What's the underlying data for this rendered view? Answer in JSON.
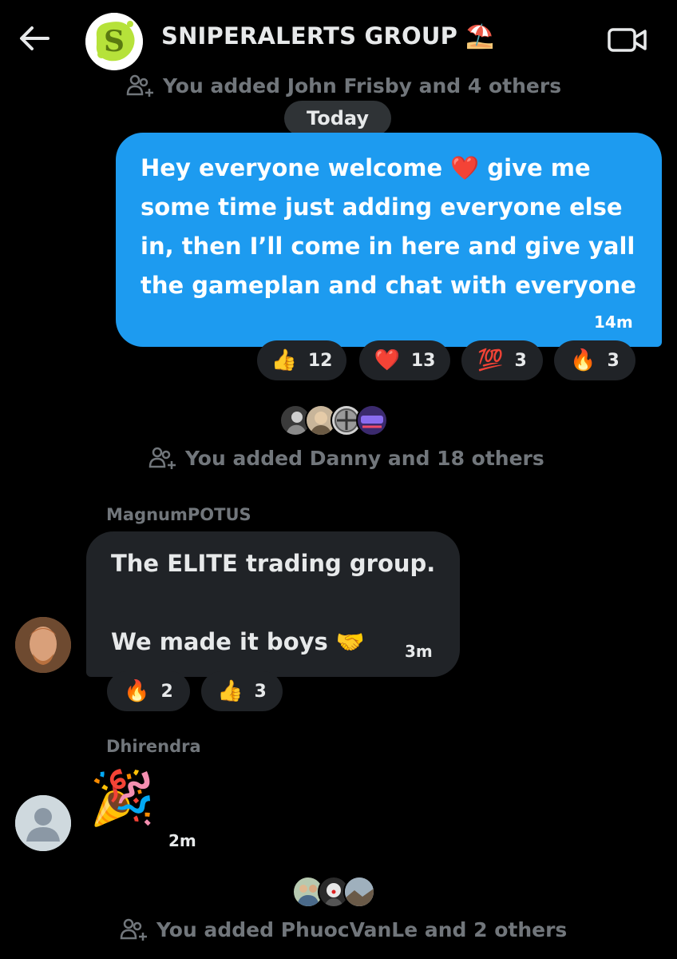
{
  "header": {
    "title": "SNIPERALERTS GROUP",
    "title_emoji": "⛱️",
    "back_icon": "arrow-left-icon",
    "video_icon": "video-camera-icon",
    "avatar_letter": "S"
  },
  "system_events": [
    {
      "text": "You added John Frisby and 4 others"
    },
    {
      "text": "You added Danny and 18 others"
    },
    {
      "text": "You added PhuocVanLe and 2 others"
    }
  ],
  "date_divider": "Today",
  "messages": [
    {
      "type": "sent",
      "lines": [
        "Hey everyone welcome ❤️ give me",
        "some time just adding everyone else",
        "in, then I’ll come in here and give yall",
        "the gameplan and chat with everyone"
      ],
      "time": "14m",
      "reactions": [
        {
          "emoji": "👍",
          "count": "12"
        },
        {
          "emoji": "❤️",
          "count": "13"
        },
        {
          "emoji": "💯",
          "count": "3"
        },
        {
          "emoji": "🔥",
          "count": "3"
        }
      ]
    },
    {
      "type": "received",
      "sender": "MagnumPOTUS",
      "lines": [
        "The ELITE trading group.",
        "We made it boys 🤝"
      ],
      "time": "3m",
      "reactions": [
        {
          "emoji": "🔥",
          "count": "2"
        },
        {
          "emoji": "👍",
          "count": "3"
        }
      ]
    },
    {
      "type": "received",
      "sender": "Dhirendra",
      "emoji": "🎉",
      "time": "2m"
    }
  ],
  "colors": {
    "background": "#000000",
    "sent_bubble": "#1d9bf0",
    "received_bubble": "#202327",
    "muted_text": "#71767b",
    "primary_text": "#e7e9ea"
  }
}
